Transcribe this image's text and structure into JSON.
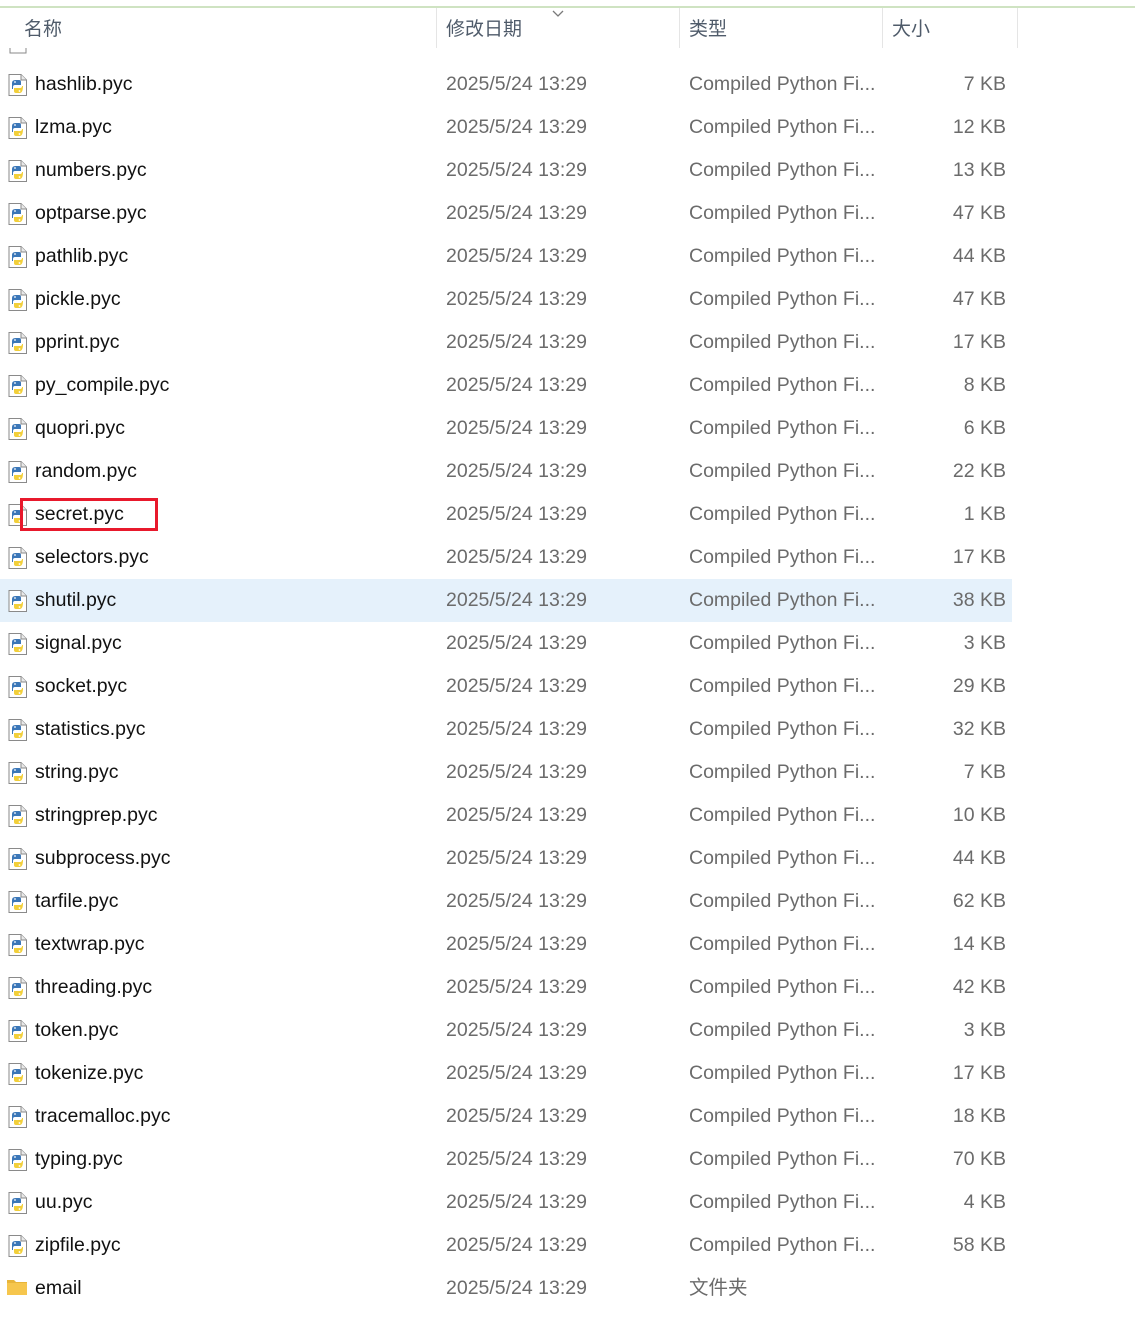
{
  "header": {
    "name": "名称",
    "date": "修改日期",
    "type": "类型",
    "size": "大小"
  },
  "colors": {
    "selected_row": "#e5f1fb",
    "highlight_box": "#e8192c",
    "folder_icon": "#f6c64d",
    "python_blue": "#3b77b8",
    "python_yellow": "#f2cf3a"
  },
  "files": [
    {
      "name": "hashlib.pyc",
      "date": "2025/5/24 13:29",
      "type": "Compiled Python Fi...",
      "size": "7 KB",
      "icon": "python-file-icon"
    },
    {
      "name": "lzma.pyc",
      "date": "2025/5/24 13:29",
      "type": "Compiled Python Fi...",
      "size": "12 KB",
      "icon": "python-file-icon"
    },
    {
      "name": "numbers.pyc",
      "date": "2025/5/24 13:29",
      "type": "Compiled Python Fi...",
      "size": "13 KB",
      "icon": "python-file-icon"
    },
    {
      "name": "optparse.pyc",
      "date": "2025/5/24 13:29",
      "type": "Compiled Python Fi...",
      "size": "47 KB",
      "icon": "python-file-icon"
    },
    {
      "name": "pathlib.pyc",
      "date": "2025/5/24 13:29",
      "type": "Compiled Python Fi...",
      "size": "44 KB",
      "icon": "python-file-icon"
    },
    {
      "name": "pickle.pyc",
      "date": "2025/5/24 13:29",
      "type": "Compiled Python Fi...",
      "size": "47 KB",
      "icon": "python-file-icon"
    },
    {
      "name": "pprint.pyc",
      "date": "2025/5/24 13:29",
      "type": "Compiled Python Fi...",
      "size": "17 KB",
      "icon": "python-file-icon"
    },
    {
      "name": "py_compile.pyc",
      "date": "2025/5/24 13:29",
      "type": "Compiled Python Fi...",
      "size": "8 KB",
      "icon": "python-file-icon"
    },
    {
      "name": "quopri.pyc",
      "date": "2025/5/24 13:29",
      "type": "Compiled Python Fi...",
      "size": "6 KB",
      "icon": "python-file-icon"
    },
    {
      "name": "random.pyc",
      "date": "2025/5/24 13:29",
      "type": "Compiled Python Fi...",
      "size": "22 KB",
      "icon": "python-file-icon"
    },
    {
      "name": "secret.pyc",
      "date": "2025/5/24 13:29",
      "type": "Compiled Python Fi...",
      "size": "1 KB",
      "icon": "python-file-icon"
    },
    {
      "name": "selectors.pyc",
      "date": "2025/5/24 13:29",
      "type": "Compiled Python Fi...",
      "size": "17 KB",
      "icon": "python-file-icon"
    },
    {
      "name": "shutil.pyc",
      "date": "2025/5/24 13:29",
      "type": "Compiled Python Fi...",
      "size": "38 KB",
      "icon": "python-file-icon",
      "selected": true
    },
    {
      "name": "signal.pyc",
      "date": "2025/5/24 13:29",
      "type": "Compiled Python Fi...",
      "size": "3 KB",
      "icon": "python-file-icon"
    },
    {
      "name": "socket.pyc",
      "date": "2025/5/24 13:29",
      "type": "Compiled Python Fi...",
      "size": "29 KB",
      "icon": "python-file-icon"
    },
    {
      "name": "statistics.pyc",
      "date": "2025/5/24 13:29",
      "type": "Compiled Python Fi...",
      "size": "32 KB",
      "icon": "python-file-icon"
    },
    {
      "name": "string.pyc",
      "date": "2025/5/24 13:29",
      "type": "Compiled Python Fi...",
      "size": "7 KB",
      "icon": "python-file-icon"
    },
    {
      "name": "stringprep.pyc",
      "date": "2025/5/24 13:29",
      "type": "Compiled Python Fi...",
      "size": "10 KB",
      "icon": "python-file-icon"
    },
    {
      "name": "subprocess.pyc",
      "date": "2025/5/24 13:29",
      "type": "Compiled Python Fi...",
      "size": "44 KB",
      "icon": "python-file-icon"
    },
    {
      "name": "tarfile.pyc",
      "date": "2025/5/24 13:29",
      "type": "Compiled Python Fi...",
      "size": "62 KB",
      "icon": "python-file-icon"
    },
    {
      "name": "textwrap.pyc",
      "date": "2025/5/24 13:29",
      "type": "Compiled Python Fi...",
      "size": "14 KB",
      "icon": "python-file-icon"
    },
    {
      "name": "threading.pyc",
      "date": "2025/5/24 13:29",
      "type": "Compiled Python Fi...",
      "size": "42 KB",
      "icon": "python-file-icon"
    },
    {
      "name": "token.pyc",
      "date": "2025/5/24 13:29",
      "type": "Compiled Python Fi...",
      "size": "3 KB",
      "icon": "python-file-icon"
    },
    {
      "name": "tokenize.pyc",
      "date": "2025/5/24 13:29",
      "type": "Compiled Python Fi...",
      "size": "17 KB",
      "icon": "python-file-icon"
    },
    {
      "name": "tracemalloc.pyc",
      "date": "2025/5/24 13:29",
      "type": "Compiled Python Fi...",
      "size": "18 KB",
      "icon": "python-file-icon"
    },
    {
      "name": "typing.pyc",
      "date": "2025/5/24 13:29",
      "type": "Compiled Python Fi...",
      "size": "70 KB",
      "icon": "python-file-icon"
    },
    {
      "name": "uu.pyc",
      "date": "2025/5/24 13:29",
      "type": "Compiled Python Fi...",
      "size": "4 KB",
      "icon": "python-file-icon"
    },
    {
      "name": "zipfile.pyc",
      "date": "2025/5/24 13:29",
      "type": "Compiled Python Fi...",
      "size": "58 KB",
      "icon": "python-file-icon"
    },
    {
      "name": "email",
      "date": "2025/5/24 13:29",
      "type": "文件夹",
      "size": "",
      "icon": "folder-icon"
    }
  ]
}
